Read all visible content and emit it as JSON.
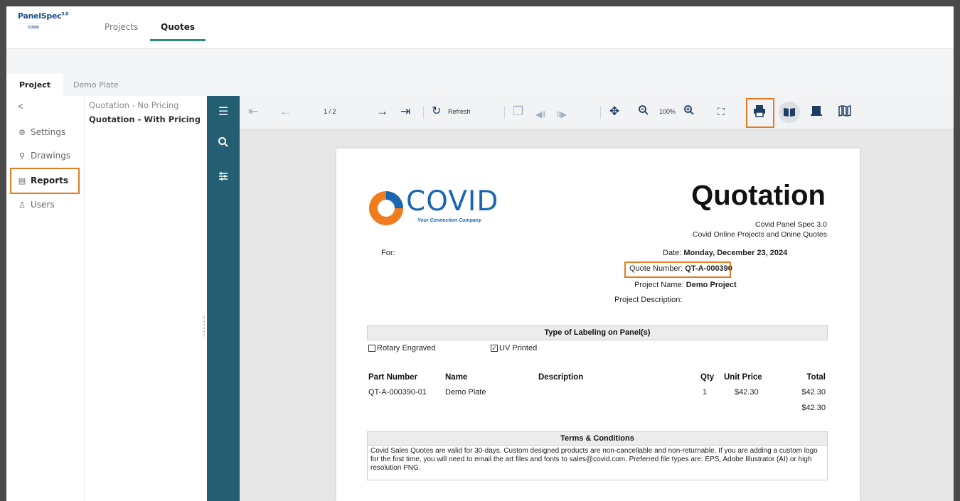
{
  "app": {
    "logo_text": "PanelSpec",
    "logo_version": "3.0",
    "logo_brand": "COVID",
    "top_tabs": [
      {
        "label": "Projects"
      },
      {
        "label": "Quotes"
      }
    ]
  },
  "project_tabs": [
    {
      "label": "Project"
    },
    {
      "label": "Demo Plate"
    }
  ],
  "sidebar": {
    "back": "<",
    "items": [
      {
        "label": "Settings",
        "icon": "settings-icon"
      },
      {
        "label": "Drawings",
        "icon": "drawings-icon"
      },
      {
        "label": "Reports",
        "icon": "reports-icon"
      },
      {
        "label": "Users",
        "icon": "users-icon"
      }
    ]
  },
  "reports": [
    {
      "label": "Quotation - No Pricing"
    },
    {
      "label": "Quotation - With Pricing"
    }
  ],
  "toolbar": {
    "page_indicator": "1 / 2",
    "refresh_label": "Refresh",
    "zoom": "100%"
  },
  "highlight_color": "#e67b22",
  "document": {
    "company_word": "COVID",
    "company_tagline": "Your Connection Company",
    "title": "Quotation",
    "subtitle1": "Covid Panel Spec 3.0",
    "subtitle2": "Covid Online Projects and Onine Quotes",
    "for_label": "For:",
    "date_label": "Date:",
    "date_value": "Monday, December 23, 2024",
    "quote_number_label": "Quote Number:",
    "quote_number_value": "QT-A-000390",
    "project_name_label": "Project Name:",
    "project_name_value": "Demo Project",
    "project_description_label": "Project Description:",
    "labeling_heading": "Type of Labeling on Panel(s)",
    "option_rotary": "Rotary Engraved",
    "option_rotary_checked": false,
    "option_uv": "UV Printed",
    "option_uv_checked": true,
    "columns": [
      "Part Number",
      "Name",
      "Description",
      "Qty",
      "Unit Price",
      "Total"
    ],
    "rows": [
      {
        "part_number": "QT-A-000390-01",
        "name": "Demo Plate",
        "description": "",
        "qty": "1",
        "unit_price": "$42.30",
        "total": "$42.30"
      }
    ],
    "grand_total": "$42.30",
    "terms_heading": "Terms & Conditions",
    "terms_text": "Covid Sales Quotes are valid for 30-days. Custom designed products are non-cancellable and non-returnable. If you are adding a custom logo for the first time, you will need to email the art files and fonts to sales@covid.com. Preferred file types are: EPS, Adobe Illustrator (AI) or high resolution PNG."
  }
}
